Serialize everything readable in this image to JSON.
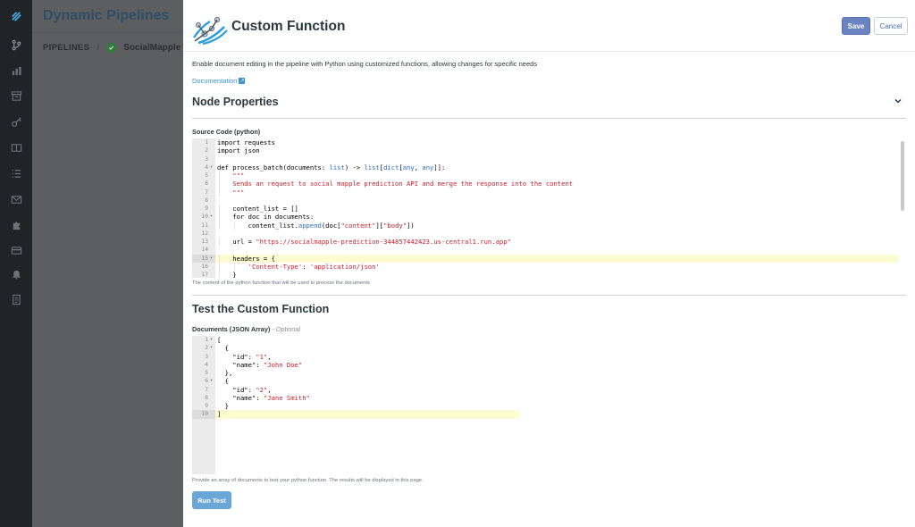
{
  "background": {
    "title": "Dynamic Pipelines",
    "breadcrumb_root": "PIPELINES",
    "breadcrumb_sep": "/",
    "breadcrumb_current": "SocialMapple Pipe"
  },
  "panel": {
    "title": "Custom Function",
    "save_label": "Save",
    "cancel_label": "Cancel",
    "description": "Enable document editing in the pipeline with Python using customized functions, allowing changes for specific needs",
    "doc_link": "Documentation",
    "node_properties_title": "Node Properties",
    "source_label": "Source Code (python)",
    "source_help": "The content of the python function that will be used to process the documents",
    "test_title": "Test the Custom Function",
    "docs_label": "Documents (JSON Array)",
    "docs_optional": "- Optional",
    "docs_help": "Provide an array of documents to test your python function. The results will be displayed in this page.",
    "run_label": "Run Test"
  },
  "source_code": {
    "line_numbers": [
      "1",
      "2",
      "3",
      "4",
      "5",
      "6",
      "7",
      "8",
      "9",
      "10",
      "11",
      "12",
      "13",
      "14",
      "15",
      "16",
      "17"
    ],
    "lines": [
      "import requests",
      "import json",
      "",
      "def process_batch(documents: list) -> list[dict[any, any]]:",
      "    \"\"\"",
      "    Sends an request to social mapple prediction API and merge the response into the content",
      "    \"\"\"",
      "",
      "    content_list = []",
      "    for doc in documents:",
      "        content_list.append(doc[\"content\"][\"body\"])",
      "",
      "    url = \"https://socialmapple-prediction-344857442423.us-central1.run.app\"",
      "",
      "    headers = {",
      "        'Content-Type': 'application/json'",
      "    }"
    ],
    "active_line": 15
  },
  "test_docs": {
    "line_numbers": [
      "1",
      "2",
      "3",
      "4",
      "5",
      "6",
      "7",
      "8",
      "9",
      "10"
    ],
    "lines": [
      "[",
      "  {",
      "    \"id\": \"1\",",
      "    \"name\": \"John Doe\"",
      "  },",
      "  {",
      "    \"id\": \"2\",",
      "    \"name\": \"Jane Smith\"",
      "  }",
      "]"
    ],
    "active_line": 10
  },
  "colors": {
    "accent": "#6a84c2",
    "link": "#3a8fd0",
    "run_button": "#6aa6d6",
    "string": "#cc1d2b",
    "builtin": "#2b6cc8"
  },
  "icons": [
    "logo-icon",
    "pipeline-icon",
    "chart-icon",
    "archive-icon",
    "key-icon",
    "book-icon",
    "list-icon",
    "mail-icon",
    "puzzle-icon",
    "card-icon",
    "alert-icon",
    "document-icon",
    "chevron-down-icon",
    "external-link-icon",
    "check-icon"
  ]
}
